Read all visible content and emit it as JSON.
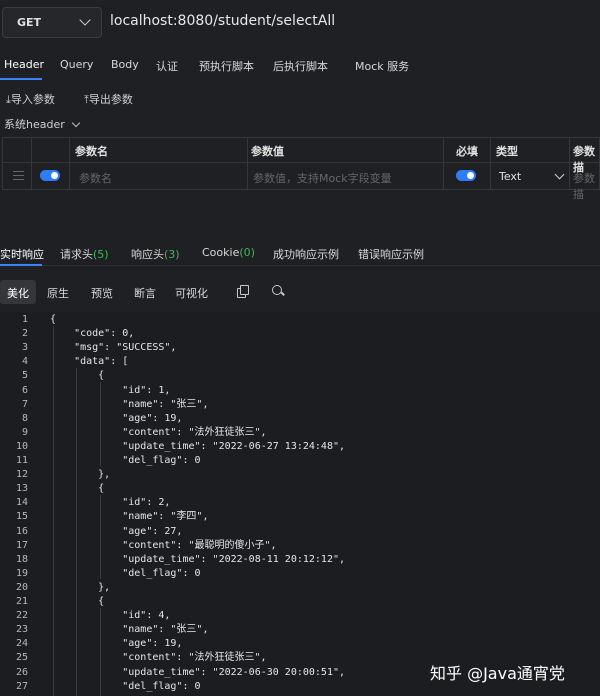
{
  "request": {
    "method": "GET",
    "url": "localhost:8080/student/selectAll"
  },
  "request_tabs": [
    "Header",
    "Query",
    "Body",
    "认证",
    "预执行脚本",
    "后执行脚本",
    "Mock 服务"
  ],
  "actions": {
    "import": "导入参数",
    "export": "导出参数",
    "system_header": "系统header"
  },
  "param_table": {
    "headers": [
      "参数名",
      "参数值",
      "必填",
      "类型",
      "参数描"
    ],
    "row": {
      "name_placeholder": "参数名",
      "value_placeholder": "参数值，支持Mock字段变量",
      "type": "Text",
      "desc_placeholder": "参数描"
    }
  },
  "response_tabs": {
    "realtime": "实时响应",
    "req_headers": "请求头",
    "req_headers_count": "(5)",
    "resp_headers": "响应头",
    "resp_headers_count": "(3)",
    "cookie": "Cookie",
    "cookie_count": "(0)",
    "success_example": "成功响应示例",
    "error_example": "错误响应示例"
  },
  "view_tabs": [
    "美化",
    "原生",
    "预览",
    "断言",
    "可视化"
  ],
  "code_lines": [
    "{",
    "    \"code\": 0,",
    "    \"msg\": \"SUCCESS\",",
    "    \"data\": [",
    "        {",
    "            \"id\": 1,",
    "            \"name\": \"张三\",",
    "            \"age\": 19,",
    "            \"content\": \"法外狂徒张三\",",
    "            \"update_time\": \"2022-06-27 13:24:48\",",
    "            \"del_flag\": 0",
    "        },",
    "        {",
    "            \"id\": 2,",
    "            \"name\": \"李四\",",
    "            \"age\": 27,",
    "            \"content\": \"最聪明的傻小子\",",
    "            \"update_time\": \"2022-08-11 20:12:12\",",
    "            \"del_flag\": 0",
    "        },",
    "        {",
    "            \"id\": 4,",
    "            \"name\": \"张三\",",
    "            \"age\": 19,",
    "            \"content\": \"法外狂徒张三\",",
    "            \"update_time\": \"2022-06-30 20:00:51\",",
    "            \"del_flag\": 0"
  ],
  "watermark": "知乎 @Java通宵党"
}
